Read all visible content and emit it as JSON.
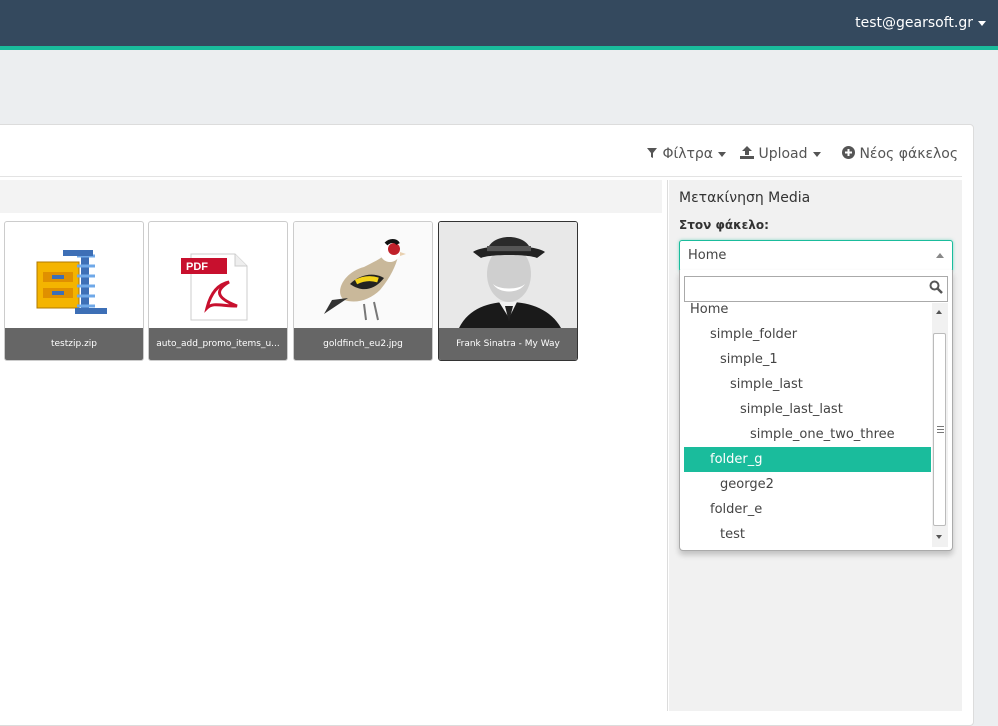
{
  "header": {
    "user_email": "test@gearsoft.gr"
  },
  "toolbar": {
    "filters_label": "Φίλτρα",
    "upload_label": "Upload",
    "new_folder_label": "Νέος φάκελος"
  },
  "media": [
    {
      "caption": "testzip.zip",
      "icon": "zip-archive-icon"
    },
    {
      "caption": "auto_add_promo_items_u...",
      "icon": "pdf-file-icon"
    },
    {
      "caption": "goldfinch_eu2.jpg",
      "icon": "goldfinch-photo"
    },
    {
      "caption": "Frank Sinatra - My Way",
      "icon": "portrait-photo"
    }
  ],
  "sidebar": {
    "title": "Μετακίνηση Media",
    "folder_label": "Στον φάκελο:",
    "selected_value": "Home",
    "search_value": "",
    "folders": [
      {
        "label": "Home",
        "depth": 0
      },
      {
        "label": "simple_folder",
        "depth": 1
      },
      {
        "label": "simple_1",
        "depth": 2
      },
      {
        "label": "simple_last",
        "depth": 3
      },
      {
        "label": "simple_last_last",
        "depth": 4
      },
      {
        "label": "simple_one_two_three",
        "depth": 5
      },
      {
        "label": "folder_g",
        "depth": 1,
        "highlighted": true
      },
      {
        "label": "george2",
        "depth": 2
      },
      {
        "label": "folder_e",
        "depth": 1
      },
      {
        "label": "test",
        "depth": 2
      }
    ]
  },
  "colors": {
    "topbar": "#34495e",
    "accent": "#1abc9c"
  }
}
